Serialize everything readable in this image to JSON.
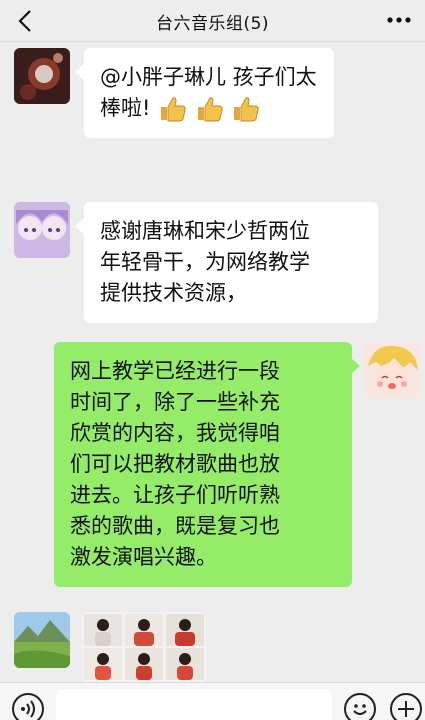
{
  "header": {
    "title": "台六音乐组(5)"
  },
  "messages": [
    {
      "side": "left",
      "lines": [
        "@小胖子琳儿 孩子们太",
        "棒啦!"
      ]
    },
    {
      "side": "left",
      "lines": [
        "感谢唐琳和宋少哲两位",
        "年轻骨干，为网络教学",
        "提供技术资源，"
      ]
    },
    {
      "side": "right",
      "lines": [
        "网上教学已经进行一段",
        "时间了，除了一些补充",
        "欣赏的内容，我觉得咱",
        "们可以把教材歌曲也放",
        "进去。让孩子们听听熟",
        "悉的歌曲，既是复习也",
        "激发演唱兴趣。"
      ]
    }
  ],
  "icons": {
    "back": "chevron-left-icon",
    "more": "more-dots-icon",
    "voice": "voice-icon",
    "emoji": "emoji-icon",
    "plus": "plus-icon",
    "thumbs": "thumbs-up-icon"
  },
  "colors": {
    "bubble_self": "#95ec69",
    "bubble_other": "#ffffff",
    "background": "#ededed"
  }
}
